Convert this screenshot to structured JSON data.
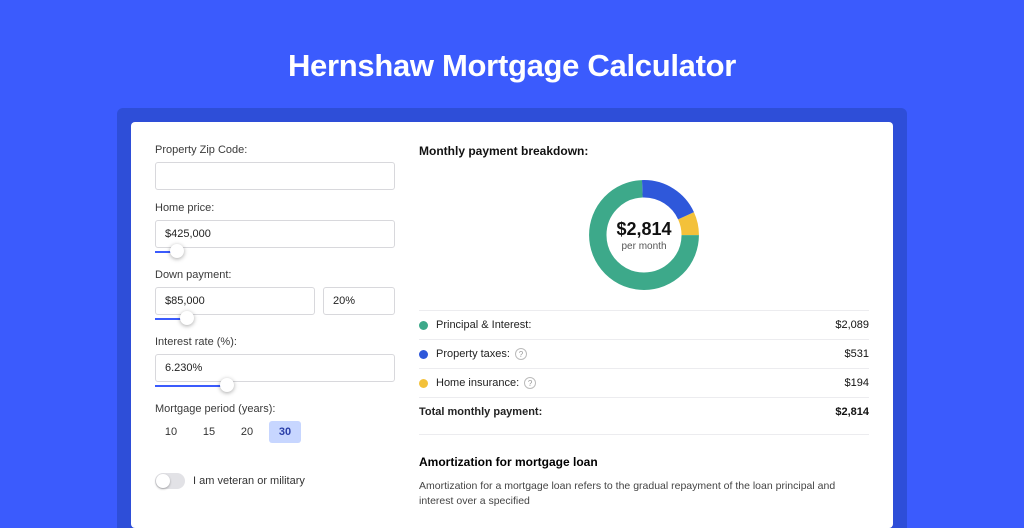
{
  "title": "Hernshaw Mortgage Calculator",
  "colors": {
    "pi": "#3da98a",
    "tax": "#2f58da",
    "ins": "#f3c13a"
  },
  "form": {
    "zip": {
      "label": "Property Zip Code:",
      "value": ""
    },
    "price": {
      "label": "Home price:",
      "value": "$425,000",
      "slider_pct": 9
    },
    "down": {
      "label": "Down payment:",
      "amount": "$85,000",
      "pct": "20%",
      "slider_pct": 20
    },
    "rate": {
      "label": "Interest rate (%):",
      "value": "6.230%",
      "slider_pct": 30
    },
    "period": {
      "label": "Mortgage period (years):",
      "options": [
        "10",
        "15",
        "20",
        "30"
      ],
      "active": "30"
    },
    "veteran": {
      "label": "I am veteran or military",
      "on": false
    }
  },
  "breakdown": {
    "header": "Monthly payment breakdown:",
    "center_amount": "$2,814",
    "center_sub": "per month",
    "rows": {
      "pi": {
        "label": "Principal & Interest:",
        "value": "$2,089",
        "info": false
      },
      "tax": {
        "label": "Property taxes:",
        "value": "$531",
        "info": true
      },
      "ins": {
        "label": "Home insurance:",
        "value": "$194",
        "info": true
      }
    },
    "total": {
      "label": "Total monthly payment:",
      "value": "$2,814"
    }
  },
  "amort": {
    "title": "Amortization for mortgage loan",
    "body": "Amortization for a mortgage loan refers to the gradual repayment of the loan principal and interest over a specified"
  },
  "chart_data": {
    "type": "pie",
    "title": "Monthly payment breakdown",
    "series": [
      {
        "name": "Principal & Interest",
        "value": 2089,
        "color": "#3da98a"
      },
      {
        "name": "Property taxes",
        "value": 531,
        "color": "#2f58da"
      },
      {
        "name": "Home insurance",
        "value": 194,
        "color": "#f3c13a"
      }
    ],
    "total": 2814,
    "center_label": "$2,814 per month"
  }
}
